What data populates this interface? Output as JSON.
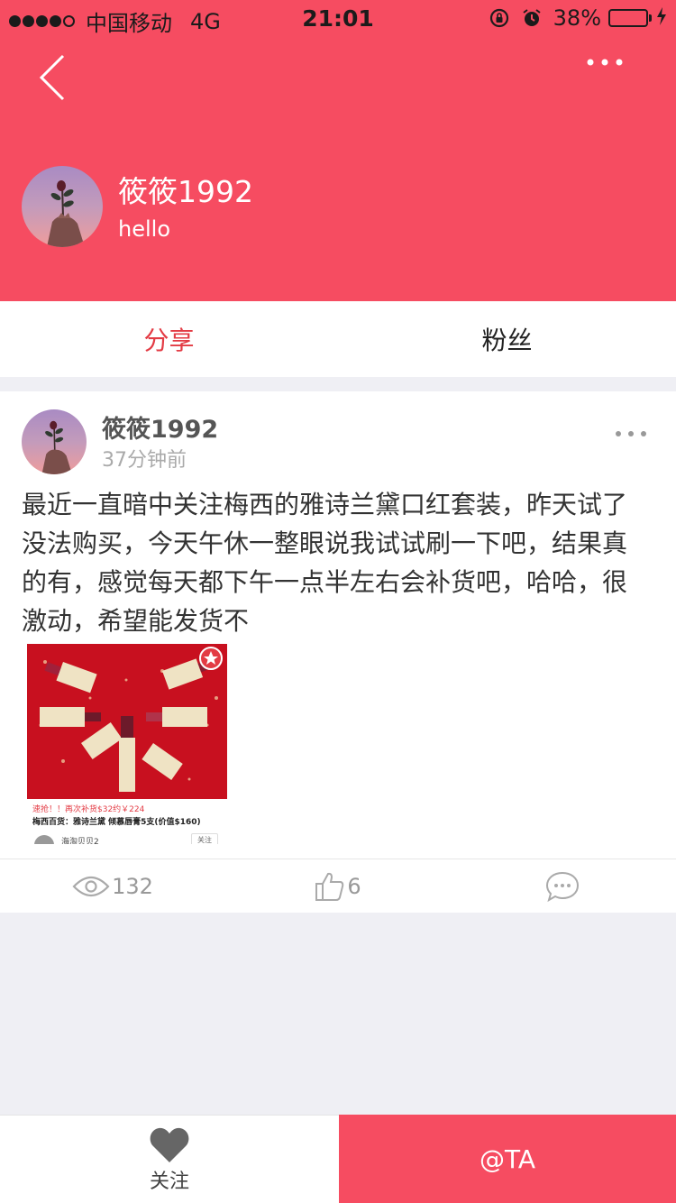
{
  "status_bar": {
    "carrier": "中国移动",
    "network": "4G",
    "time": "21:01",
    "battery_percent": "38%",
    "battery_level": 0.38
  },
  "profile": {
    "name": "筱筱1992",
    "bio": "hello"
  },
  "tabs": [
    {
      "label": "分享",
      "active": true
    },
    {
      "label": "粉丝",
      "active": false
    }
  ],
  "post": {
    "author": "筱筱1992",
    "time_ago": "37分钟前",
    "text": "最近一直暗中关注梅西的雅诗兰黛口红套装，昨天试了没法购买，今天午休一整眼说我试试刷一下吧，结果真的有，感觉每天都下午一点半左右会补货吧，哈哈，很激动，希望能发货不",
    "image": {
      "caption_promo": "速抢！！再次补货$32约￥224",
      "caption_title": "梅西百货：雅诗兰黛 倾慕唇膏5支(价值$160)",
      "user": "海淘贝贝2",
      "follow": "关注"
    },
    "views": "132",
    "likes": "6"
  },
  "bottom_bar": {
    "follow_label": "关注",
    "at_label": "@TA"
  },
  "colors": {
    "brand_red": "#f64c61",
    "active_tab": "#e33b44"
  }
}
